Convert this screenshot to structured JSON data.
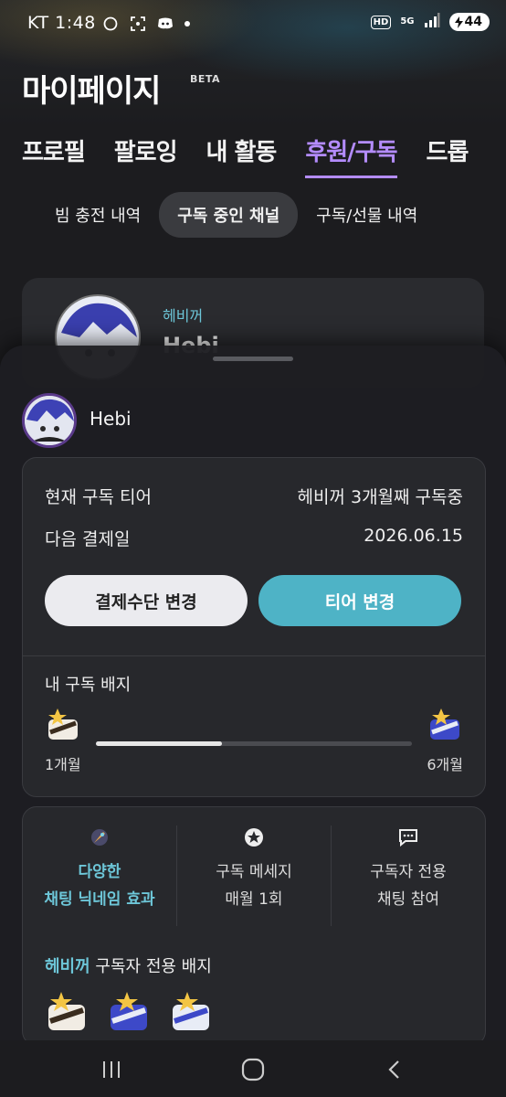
{
  "status_bar": {
    "time": "1:48",
    "carrier": "KT",
    "network": "5G",
    "battery": "44"
  },
  "header": {
    "title": "마이페이지",
    "beta": "BETA"
  },
  "tabs": [
    "프로필",
    "팔로잉",
    "내 활동",
    "후원/구독",
    "드롭"
  ],
  "subtabs": [
    "빔 충전 내역",
    "구독 중인 채널",
    "구독/선물 내역"
  ],
  "background_card": {
    "channel_label": "헤비꺼",
    "name_partial": "Hebi"
  },
  "sheet": {
    "channel_name": "Hebi",
    "rows": [
      {
        "label": "현재 구독 티어",
        "value": "헤비꺼 3개월째 구독중"
      },
      {
        "label": "다음 결제일",
        "value": "2026.06.15"
      }
    ],
    "buttons": {
      "payment": "결제수단 변경",
      "tier": "티어 변경"
    },
    "badge_section": {
      "title": "내 구독 배지",
      "start_label": "1개월",
      "end_label": "6개월",
      "progress": 0.4
    },
    "benefits": [
      {
        "line1": "다양한",
        "line2": "채팅 닉네임 효과",
        "icon": "rocket-icon",
        "highlight": true
      },
      {
        "line1": "구독 메세지",
        "line2": "매월 1회",
        "icon": "star-circle-icon",
        "highlight": false
      },
      {
        "line1": "구독자 전용",
        "line2": "채팅 참여",
        "icon": "chat-icon",
        "highlight": false
      }
    ],
    "subscriber_badge": {
      "channel": "헤비꺼",
      "text": "구독자 전용 배지"
    }
  },
  "colors": {
    "accent_purple": "#b48cff",
    "teal": "#4eb3c6",
    "cyan_text": "#6dc6d8"
  }
}
